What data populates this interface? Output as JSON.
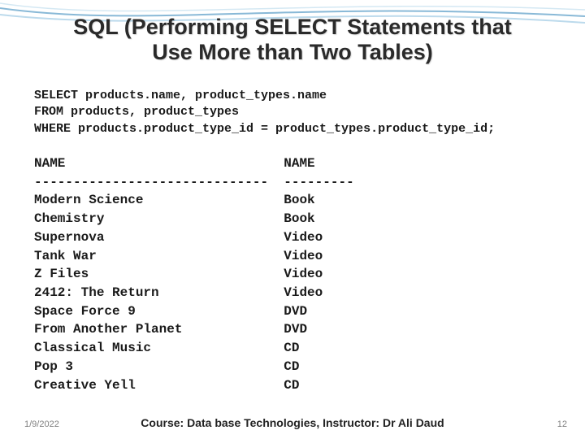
{
  "title_line1": "SQL (Performing SELECT Statements that",
  "title_line2": "Use More than Two Tables)",
  "sql": {
    "line1": "SELECT products.name, product_types.name",
    "line2": "FROM products, product_types",
    "line3": "WHERE products.product_type_id = product_types.product_type_id;"
  },
  "results": {
    "header": "NAME                            NAME",
    "divider": "------------------------------  ---------",
    "rows": [
      "Modern Science                  Book",
      "Chemistry                       Book",
      "Supernova                       Video",
      "Tank War                        Video",
      "Z Files                         Video",
      "2412: The Return                Video",
      "Space Force 9                   DVD",
      "From Another Planet             DVD",
      "Classical Music                 CD",
      "Pop 3                           CD",
      "Creative Yell                   CD"
    ]
  },
  "footer": {
    "date": "1/9/2022",
    "course": "Course: Data base Technologies, Instructor: Dr Ali Daud",
    "page": "12"
  },
  "chart_data": {
    "type": "table",
    "columns": [
      "NAME",
      "NAME"
    ],
    "rows": [
      [
        "Modern Science",
        "Book"
      ],
      [
        "Chemistry",
        "Book"
      ],
      [
        "Supernova",
        "Video"
      ],
      [
        "Tank War",
        "Video"
      ],
      [
        "Z Files",
        "Video"
      ],
      [
        "2412: The Return",
        "Video"
      ],
      [
        "Space Force 9",
        "DVD"
      ],
      [
        "From Another Planet",
        "DVD"
      ],
      [
        "Classical Music",
        "CD"
      ],
      [
        "Pop 3",
        "CD"
      ],
      [
        "Creative Yell",
        "CD"
      ]
    ]
  }
}
